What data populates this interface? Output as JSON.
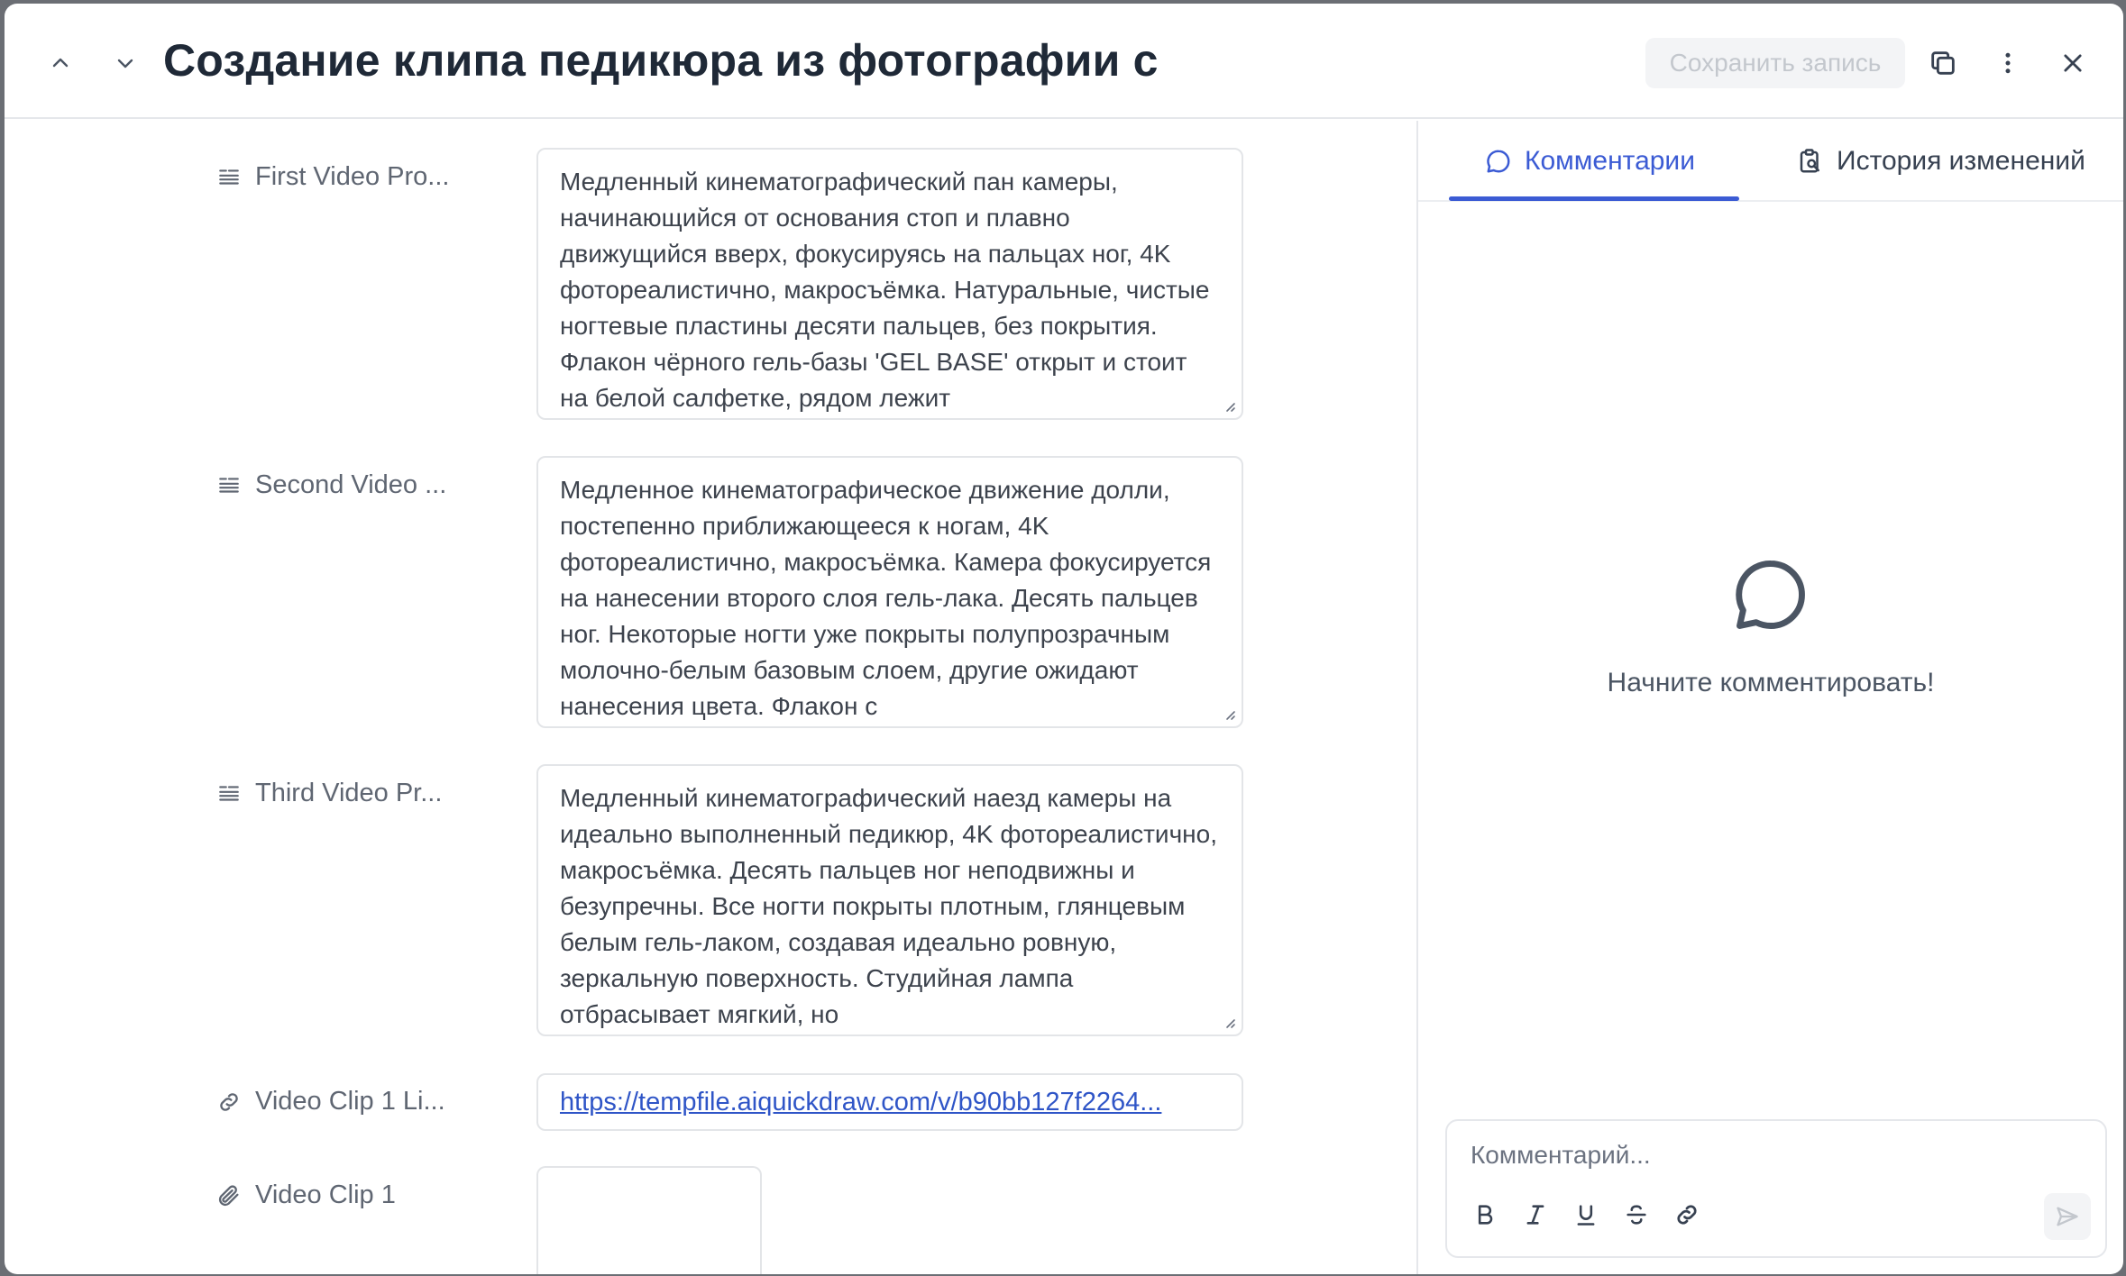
{
  "header": {
    "title": "Создание клипа педикюра из фотографии с",
    "save_label": "Сохранить запись"
  },
  "fields": [
    {
      "label": "First Video Pro...",
      "value": "Медленный кинематографический пан камеры, начинающийся от основания стоп и плавно движущийся вверх, фокусируясь на пальцах ног, 4K фотореалистично, макросъёмка. Натуральные, чистые ногтевые пластины десяти пальцев, без покрытия. Флакон чёрного гель-базы 'GEL BASE' открыт и стоит на белой салфетке, рядом лежит"
    },
    {
      "label": "Second Video ...",
      "value": "Медленное кинематографическое движение долли, постепенно приближающееся к ногам, 4K фотореалистично, макросъёмка. Камера фокусируется на нанесении второго слоя гель-лака. Десять пальцев ног. Некоторые ногти уже покрыты полупрозрачным молочно-белым базовым слоем, другие ожидают нанесения цвета. Флакон с"
    },
    {
      "label": "Third Video Pr...",
      "value": "Медленный кинематографический наезд камеры на идеально выполненный педикюр, 4K фотореалистично, макросъёмка. Десять пальцев ног неподвижны и безупречны. Все ногти покрыты плотным, глянцевым белым гель-лаком, создавая идеально ровную, зеркальную поверхность. Студийная лампа отбрасывает мягкий, но"
    },
    {
      "label": "Video Clip 1 Li...",
      "value": "https://tempfile.aiquickdraw.com/v/b90bb127f2264..."
    },
    {
      "label": "Video Clip 1"
    }
  ],
  "sidebar": {
    "tab_comments": "Комментарии",
    "tab_history": "История изменений",
    "empty_text": "Начните комментировать!",
    "comment_placeholder": "Комментарий..."
  },
  "colors": {
    "accent": "#3b5bd4",
    "link": "#2f55c7"
  }
}
